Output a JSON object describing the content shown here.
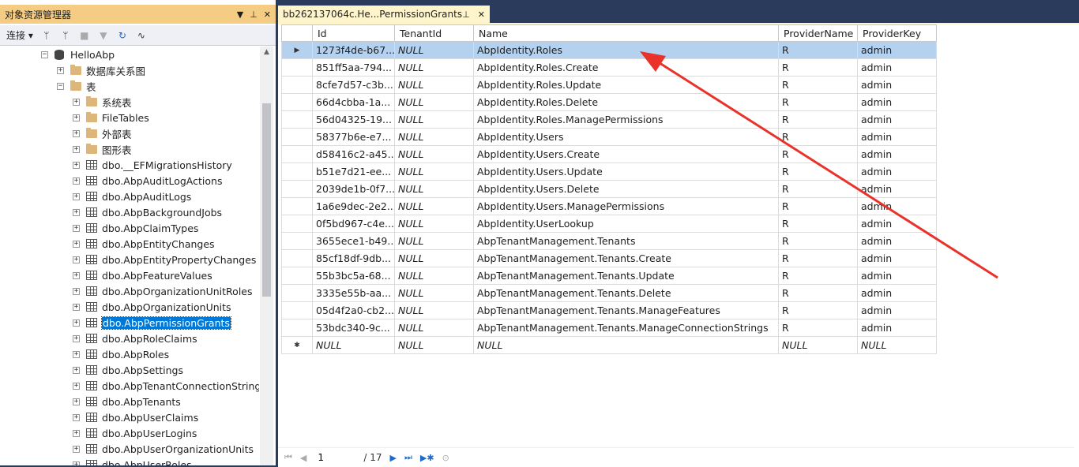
{
  "object_explorer": {
    "title": "对象资源管理器",
    "toolbar": {
      "connect": "连接 ▾"
    },
    "db": "HelloAbp",
    "items": [
      {
        "label": "数据库关系图",
        "kind": "folder"
      },
      {
        "label": "表",
        "kind": "folder"
      },
      {
        "label": "系统表",
        "kind": "folder"
      },
      {
        "label": "FileTables",
        "kind": "folder"
      },
      {
        "label": "外部表",
        "kind": "folder"
      },
      {
        "label": "图形表",
        "kind": "folder"
      },
      {
        "label": "dbo.__EFMigrationsHistory",
        "kind": "table"
      },
      {
        "label": "dbo.AbpAuditLogActions",
        "kind": "table"
      },
      {
        "label": "dbo.AbpAuditLogs",
        "kind": "table"
      },
      {
        "label": "dbo.AbpBackgroundJobs",
        "kind": "table"
      },
      {
        "label": "dbo.AbpClaimTypes",
        "kind": "table"
      },
      {
        "label": "dbo.AbpEntityChanges",
        "kind": "table"
      },
      {
        "label": "dbo.AbpEntityPropertyChanges",
        "kind": "table"
      },
      {
        "label": "dbo.AbpFeatureValues",
        "kind": "table"
      },
      {
        "label": "dbo.AbpOrganizationUnitRoles",
        "kind": "table"
      },
      {
        "label": "dbo.AbpOrganizationUnits",
        "kind": "table"
      },
      {
        "label": "dbo.AbpPermissionGrants",
        "kind": "table"
      },
      {
        "label": "dbo.AbpRoleClaims",
        "kind": "table"
      },
      {
        "label": "dbo.AbpRoles",
        "kind": "table"
      },
      {
        "label": "dbo.AbpSettings",
        "kind": "table"
      },
      {
        "label": "dbo.AbpTenantConnectionStrings",
        "kind": "table"
      },
      {
        "label": "dbo.AbpTenants",
        "kind": "table"
      },
      {
        "label": "dbo.AbpUserClaims",
        "kind": "table"
      },
      {
        "label": "dbo.AbpUserLogins",
        "kind": "table"
      },
      {
        "label": "dbo.AbpUserOrganizationUnits",
        "kind": "table"
      },
      {
        "label": "dbo.AbpUserRoles",
        "kind": "table"
      }
    ]
  },
  "tab": {
    "title": "bb262137064c.He...PermissionGrants"
  },
  "grid": {
    "columns": [
      "Id",
      "TenantId",
      "Name",
      "ProviderName",
      "ProviderKey"
    ],
    "rows": [
      [
        "1273f4de-b67...",
        "NULL",
        "AbpIdentity.Roles",
        "R",
        "admin"
      ],
      [
        "851ff5aa-794...",
        "NULL",
        "AbpIdentity.Roles.Create",
        "R",
        "admin"
      ],
      [
        "8cfe7d57-c3b...",
        "NULL",
        "AbpIdentity.Roles.Update",
        "R",
        "admin"
      ],
      [
        "66d4cbba-1a...",
        "NULL",
        "AbpIdentity.Roles.Delete",
        "R",
        "admin"
      ],
      [
        "56d04325-19...",
        "NULL",
        "AbpIdentity.Roles.ManagePermissions",
        "R",
        "admin"
      ],
      [
        "58377b6e-e7...",
        "NULL",
        "AbpIdentity.Users",
        "R",
        "admin"
      ],
      [
        "d58416c2-a45...",
        "NULL",
        "AbpIdentity.Users.Create",
        "R",
        "admin"
      ],
      [
        "b51e7d21-ee...",
        "NULL",
        "AbpIdentity.Users.Update",
        "R",
        "admin"
      ],
      [
        "2039de1b-0f7...",
        "NULL",
        "AbpIdentity.Users.Delete",
        "R",
        "admin"
      ],
      [
        "1a6e9dec-2e2...",
        "NULL",
        "AbpIdentity.Users.ManagePermissions",
        "R",
        "admin"
      ],
      [
        "0f5bd967-c4e...",
        "NULL",
        "AbpIdentity.UserLookup",
        "R",
        "admin"
      ],
      [
        "3655ece1-b49...",
        "NULL",
        "AbpTenantManagement.Tenants",
        "R",
        "admin"
      ],
      [
        "85cf18df-9db...",
        "NULL",
        "AbpTenantManagement.Tenants.Create",
        "R",
        "admin"
      ],
      [
        "55b3bc5a-68...",
        "NULL",
        "AbpTenantManagement.Tenants.Update",
        "R",
        "admin"
      ],
      [
        "3335e55b-aa...",
        "NULL",
        "AbpTenantManagement.Tenants.Delete",
        "R",
        "admin"
      ],
      [
        "05d4f2a0-cb2...",
        "NULL",
        "AbpTenantManagement.Tenants.ManageFeatures",
        "R",
        "admin"
      ],
      [
        "53bdc340-9c...",
        "NULL",
        "AbpTenantManagement.Tenants.ManageConnectionStrings",
        "R",
        "admin"
      ]
    ],
    "new_row": [
      "NULL",
      "NULL",
      "NULL",
      "NULL",
      "NULL"
    ],
    "row_indicator": "▶",
    "new_indicator": "✱"
  },
  "nav": {
    "page": "1",
    "total": "/ 17"
  },
  "colors": {
    "selected_row": "#b4d2f0",
    "title_bar": "#f5cc84",
    "arrow": "#e8322a"
  }
}
